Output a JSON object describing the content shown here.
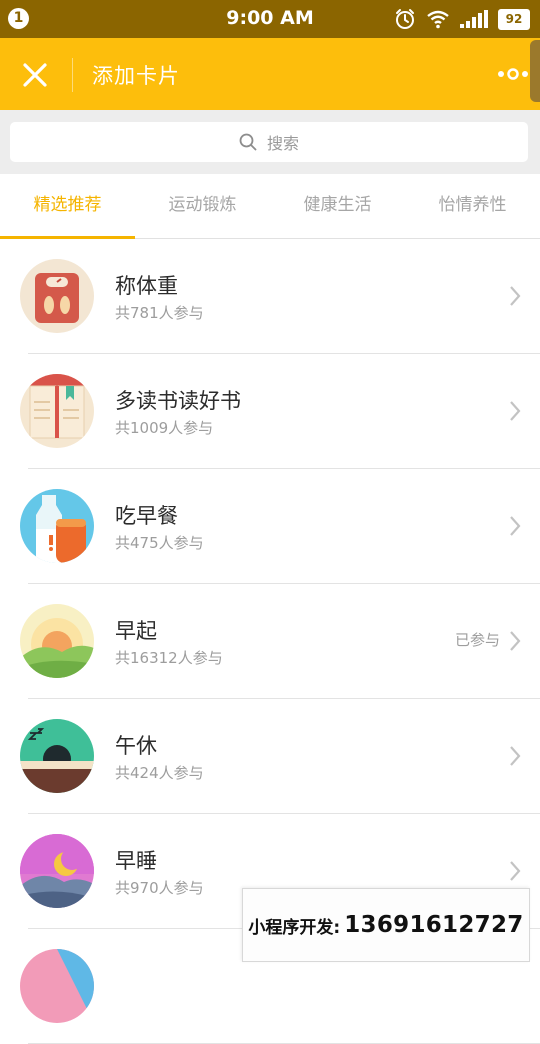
{
  "status_bar": {
    "notification_count": "1",
    "time": "9:00 AM",
    "battery": "92",
    "icons": [
      "alarm-icon",
      "wifi-icon",
      "signal-icon",
      "battery-icon"
    ]
  },
  "header": {
    "title": "添加卡片",
    "close_icon": "close-icon",
    "more_icon": "more-icon",
    "background": "#fdbe0c"
  },
  "search": {
    "placeholder": "搜索"
  },
  "tabs": [
    {
      "label": "精选推荐",
      "active": true
    },
    {
      "label": "运动锻炼",
      "active": false
    },
    {
      "label": "健康生活",
      "active": false
    },
    {
      "label": "怡情养性",
      "active": false
    }
  ],
  "accent": "#f5b400",
  "cards": [
    {
      "name": "称体重",
      "count": "共781人参与",
      "status": "",
      "icon": "weight-scale-icon"
    },
    {
      "name": "多读书读好书",
      "count": "共1009人参与",
      "status": "",
      "icon": "book-icon"
    },
    {
      "name": "吃早餐",
      "count": "共475人参与",
      "status": "",
      "icon": "breakfast-icon"
    },
    {
      "name": "早起",
      "count": "共16312人参与",
      "status": "已参与",
      "icon": "sunrise-icon"
    },
    {
      "name": "午休",
      "count": "共424人参与",
      "status": "",
      "icon": "nap-icon"
    },
    {
      "name": "早睡",
      "count": "共970人参与",
      "status": "",
      "icon": "moon-icon"
    }
  ],
  "watermark": {
    "label": "小程序开发:",
    "number": "13691612727"
  }
}
